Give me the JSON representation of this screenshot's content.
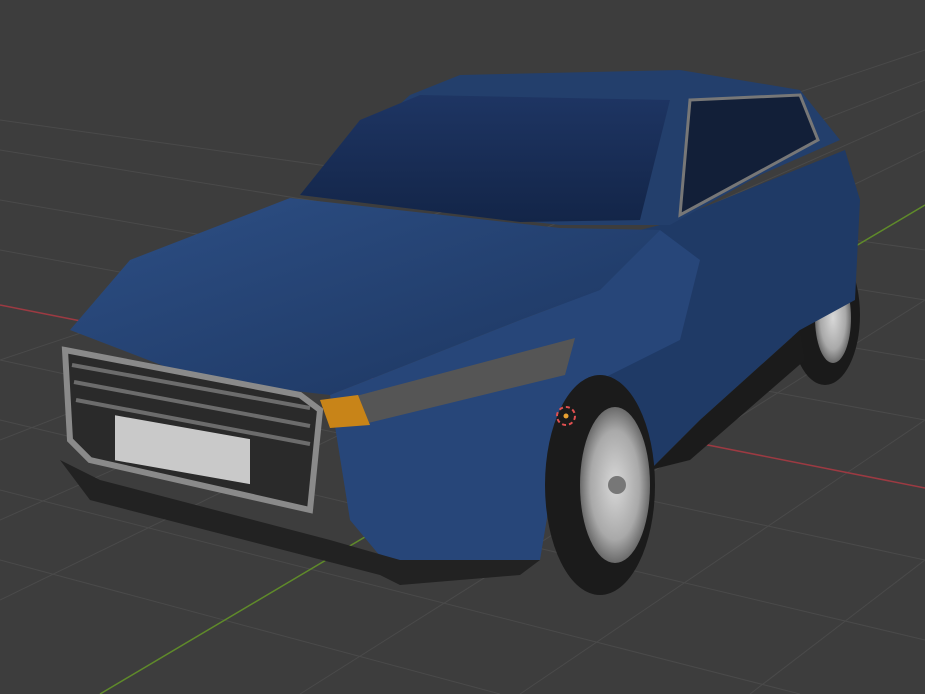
{
  "viewport": {
    "colors": {
      "background": "#3d3d3d",
      "grid": "#4a4a4a",
      "x_axis": "#9c3a42",
      "y_axis": "#5f8a2a",
      "car_body": "#24416f",
      "car_body_dark": "#162a4c",
      "cursor": "#e05050"
    },
    "objects": [
      "car-model",
      "3d-cursor"
    ]
  }
}
